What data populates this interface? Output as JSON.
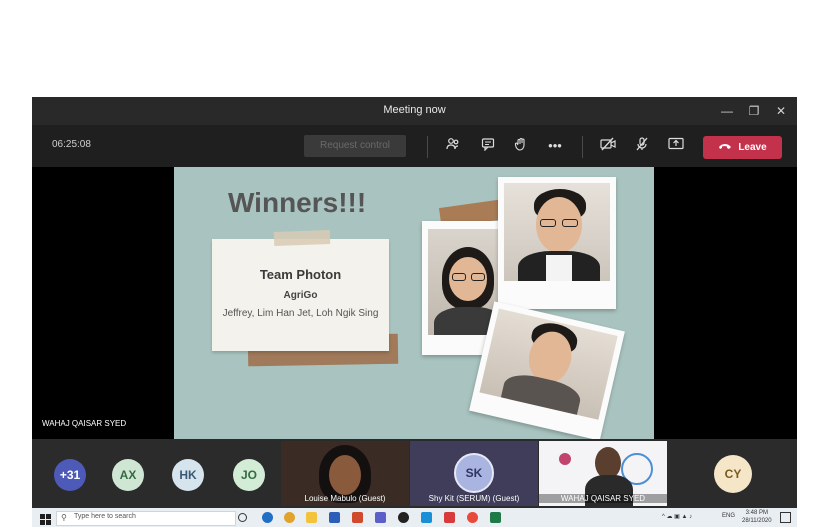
{
  "window": {
    "title": "Meeting now"
  },
  "toolbar": {
    "timer": "06:25:08",
    "request_control": "Request control",
    "leave": "Leave"
  },
  "slide": {
    "title": "Winners!!!",
    "team": "Team Photon",
    "project": "AgriGo",
    "members": "Jeffrey, Lim Han Jet, Loh Ngik Sing"
  },
  "presenter_name": "WAHAJ QAISAR SYED",
  "participants": {
    "overflow": "+31",
    "avatars": [
      "AX",
      "HK",
      "JO"
    ],
    "tiles": [
      {
        "label": "Louise Mabulo (Guest)"
      },
      {
        "label": "Shy Kit (SERUM) (Guest)",
        "initials": "SK"
      },
      {
        "label": "WAHAJ QAISAR SYED"
      }
    ],
    "last_avatar": "CY"
  },
  "taskbar": {
    "search_placeholder": "Type here to search",
    "language": "ENG",
    "time": "3:48 PM",
    "date": "28/11/2020"
  },
  "colors": {
    "leave": "#c4314b",
    "slide_bg": "#a9c4c0",
    "avatar_ax": "#cfe6d4",
    "avatar_hk": "#d6e4ee",
    "avatar_jo": "#d3ecd6",
    "avatar_cy": "#f6e6c8",
    "avatar_overflow": "#4d5ab8"
  }
}
